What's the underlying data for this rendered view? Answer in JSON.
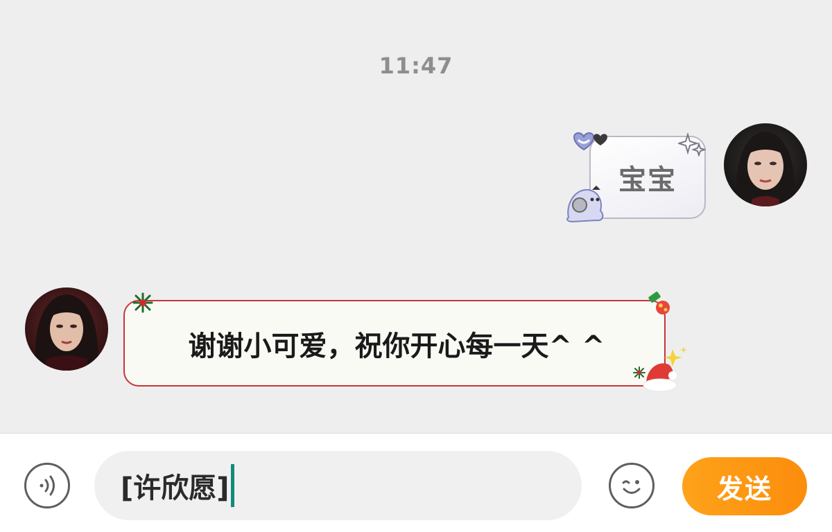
{
  "chat": {
    "timestamp": "11:47",
    "messages": [
      {
        "sender": "self",
        "text": "宝宝"
      },
      {
        "sender": "other",
        "text": "谢谢小可爱，祝你开心每一天^ ^"
      }
    ]
  },
  "input_bar": {
    "value": "[许欣愿]",
    "send_label": "发送"
  },
  "icons": {
    "voice": "voice-wave-icon",
    "emoji": "smiley-icon"
  },
  "colors": {
    "send_button": "#fb9612",
    "caret": "#128a7a",
    "incoming_border": "#c6343a"
  }
}
